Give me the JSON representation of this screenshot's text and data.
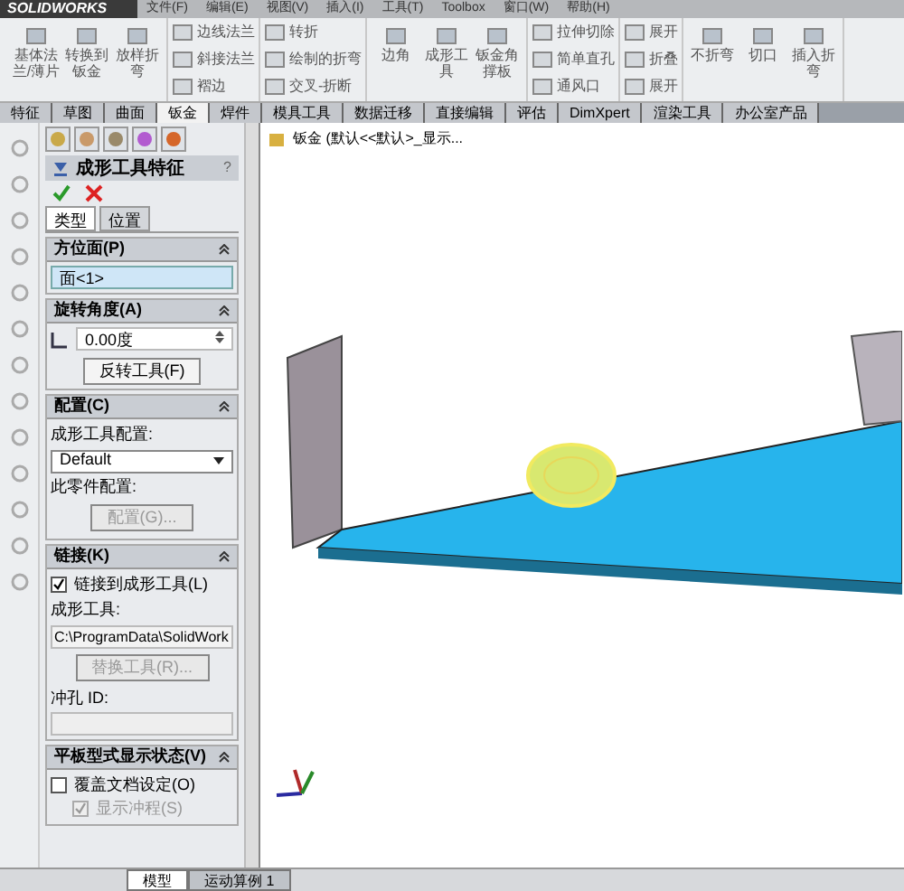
{
  "app": {
    "logo": "SOLIDWORKS",
    "menu": [
      "文件(F)",
      "编辑(E)",
      "视图(V)",
      "插入(I)",
      "工具(T)",
      "Toolbox",
      "窗口(W)",
      "帮助(H)"
    ]
  },
  "ribbon": {
    "groups": [
      {
        "kind": "large",
        "items": [
          "基体法兰/薄片",
          "转换到钣金",
          "放样折弯"
        ]
      },
      {
        "kind": "small",
        "items": [
          "边线法兰",
          "斜接法兰",
          "褶边"
        ]
      },
      {
        "kind": "small",
        "items": [
          "转折",
          "绘制的折弯",
          "交叉-折断"
        ]
      },
      {
        "kind": "large",
        "items": [
          "边角",
          "成形工具",
          "钣金角撑板"
        ]
      },
      {
        "kind": "small",
        "items": [
          "拉伸切除",
          "简单直孔",
          "通风口"
        ]
      },
      {
        "kind": "small",
        "items": [
          "展开",
          "折叠",
          "展开"
        ]
      },
      {
        "kind": "large",
        "items": [
          "不折弯",
          "切口",
          "插入折弯"
        ]
      }
    ]
  },
  "tabs": [
    {
      "label": "特征",
      "selected": false
    },
    {
      "label": "草图",
      "selected": false
    },
    {
      "label": "曲面",
      "selected": false
    },
    {
      "label": "钣金",
      "selected": true
    },
    {
      "label": "焊件",
      "selected": false
    },
    {
      "label": "模具工具",
      "selected": false
    },
    {
      "label": "数据迁移",
      "selected": false
    },
    {
      "label": "直接编辑",
      "selected": false
    },
    {
      "label": "评估",
      "selected": false
    },
    {
      "label": "DimXpert",
      "selected": false
    },
    {
      "label": "渲染工具",
      "selected": false
    },
    {
      "label": "办公室产品",
      "selected": false
    }
  ],
  "property_manager": {
    "title": "成形工具特征",
    "help": "?",
    "subtabs": [
      {
        "label": "类型",
        "selected": true
      },
      {
        "label": "位置",
        "selected": false
      }
    ],
    "orientation": {
      "header": "方位面(P)",
      "value": "面<1>"
    },
    "rotation": {
      "header": "旋转角度(A)",
      "value": "0.00度",
      "button": "反转工具(F)"
    },
    "config": {
      "header": "配置(C)",
      "tool_label": "成形工具配置:",
      "tool_value": "Default",
      "part_label": "此零件配置:",
      "button": "配置(G)...",
      "button_disabled": true
    },
    "link": {
      "header": "链接(K)",
      "checkbox": {
        "label": "链接到成形工具(L)",
        "checked": true
      },
      "tool_label": "成形工具:",
      "tool_value": "C:\\ProgramData\\SolidWork",
      "button": "替换工具(R)...",
      "button_disabled": true,
      "punch_label": "冲孔 ID:"
    },
    "flat": {
      "header": "平板型式显示状态(V)",
      "checkboxes": [
        {
          "label": "覆盖文档设定(O)",
          "checked": false,
          "disabled": false
        },
        {
          "label": "显示冲程(S)",
          "checked": true,
          "disabled": true
        }
      ]
    }
  },
  "viewport": {
    "tree_text": "钣金 (默认<<默认>_显示..."
  },
  "bottom_tabs": [
    {
      "label": "模型",
      "selected": true
    },
    {
      "label": "运动算例 1",
      "selected": false
    }
  ]
}
